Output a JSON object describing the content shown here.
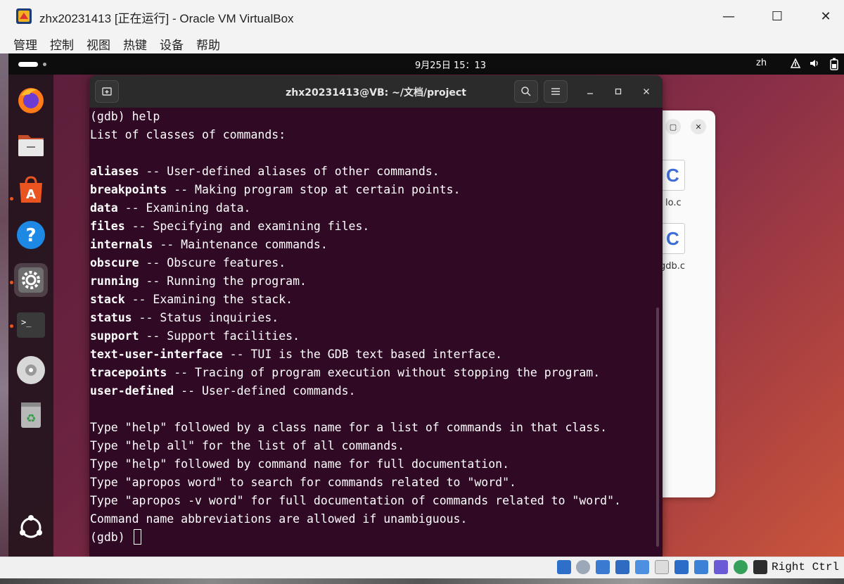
{
  "window": {
    "title": "zhx20231413 [正在运行] - Oracle VM VirtualBox",
    "minimize": "—",
    "maximize": "☐",
    "close": "✕"
  },
  "menu": [
    "管理",
    "控制",
    "视图",
    "热键",
    "设备",
    "帮助"
  ],
  "guest_topbar": {
    "clock": "9月25日  15：13",
    "language": "zh"
  },
  "dock": {
    "items": [
      {
        "name": "firefox",
        "active": false
      },
      {
        "name": "files",
        "active": false
      },
      {
        "name": "app-center",
        "active": false
      },
      {
        "name": "help",
        "active": false
      },
      {
        "name": "settings",
        "active": true
      },
      {
        "name": "terminal",
        "active": false
      },
      {
        "name": "disc",
        "active": false
      },
      {
        "name": "trash",
        "active": false
      },
      {
        "name": "show-apps",
        "active": false
      }
    ]
  },
  "files_window": {
    "file1": "lo.c",
    "file2": "gdb.c"
  },
  "terminal": {
    "title": "zhx20231413@VB: ~/文档/project",
    "lines": [
      {
        "kw": "",
        "text": "(gdb) help"
      },
      {
        "kw": "",
        "text": "List of classes of commands:"
      },
      {
        "kw": "",
        "text": ""
      },
      {
        "kw": "aliases",
        "text": " -- User-defined aliases of other commands."
      },
      {
        "kw": "breakpoints",
        "text": " -- Making program stop at certain points."
      },
      {
        "kw": "data",
        "text": " -- Examining data."
      },
      {
        "kw": "files",
        "text": " -- Specifying and examining files."
      },
      {
        "kw": "internals",
        "text": " -- Maintenance commands."
      },
      {
        "kw": "obscure",
        "text": " -- Obscure features."
      },
      {
        "kw": "running",
        "text": " -- Running the program."
      },
      {
        "kw": "stack",
        "text": " -- Examining the stack."
      },
      {
        "kw": "status",
        "text": " -- Status inquiries."
      },
      {
        "kw": "support",
        "text": " -- Support facilities."
      },
      {
        "kw": "text-user-interface",
        "text": " -- TUI is the GDB text based interface."
      },
      {
        "kw": "tracepoints",
        "text": " -- Tracing of program execution without stopping the program."
      },
      {
        "kw": "user-defined",
        "text": " -- User-defined commands."
      },
      {
        "kw": "",
        "text": ""
      },
      {
        "kw": "",
        "text": "Type \"help\" followed by a class name for a list of commands in that class."
      },
      {
        "kw": "",
        "text": "Type \"help all\" for the list of all commands."
      },
      {
        "kw": "",
        "text": "Type \"help\" followed by command name for full documentation."
      },
      {
        "kw": "",
        "text": "Type \"apropos word\" to search for commands related to \"word\"."
      },
      {
        "kw": "",
        "text": "Type \"apropos -v word\" for full documentation of commands related to \"word\"."
      },
      {
        "kw": "",
        "text": "Command name abbreviations are allowed if unambiguous."
      }
    ],
    "prompt": "(gdb) "
  },
  "status_bar": {
    "host_key": "Right Ctrl"
  },
  "colors": {
    "terminal_bg": "#300a24",
    "accent": "#e95420"
  }
}
